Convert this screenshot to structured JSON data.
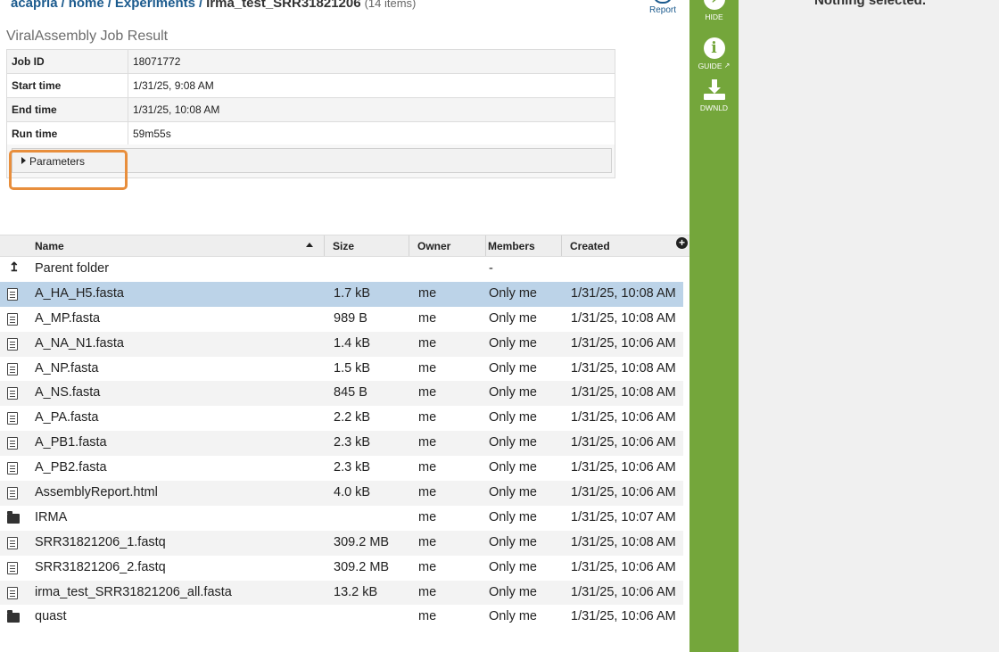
{
  "breadcrumb": {
    "parts": [
      "acapria",
      "home",
      "Experiments"
    ],
    "current": "irma_test_SRR31821206",
    "count": "(14 items)"
  },
  "report_label": "Report",
  "result_title": "ViralAssembly Job Result",
  "job": {
    "rows": [
      {
        "key": "Job ID",
        "value": "18071772"
      },
      {
        "key": "Start time",
        "value": "1/31/25, 9:08 AM"
      },
      {
        "key": "End time",
        "value": "1/31/25, 10:08 AM"
      },
      {
        "key": "Run time",
        "value": "59m55s"
      }
    ],
    "parameters_label": "Parameters"
  },
  "grid": {
    "columns": {
      "name": "Name",
      "size": "Size",
      "owner": "Owner",
      "members": "Members",
      "created": "Created"
    },
    "parent": {
      "name": "Parent folder",
      "members": "-"
    },
    "rows": [
      {
        "type": "file",
        "name": "A_HA_H5.fasta",
        "size": "1.7 kB",
        "owner": "me",
        "members": "Only me",
        "created": "1/31/25, 10:08 AM",
        "selected": true
      },
      {
        "type": "file",
        "name": "A_MP.fasta",
        "size": "989 B",
        "owner": "me",
        "members": "Only me",
        "created": "1/31/25, 10:08 AM"
      },
      {
        "type": "file",
        "name": "A_NA_N1.fasta",
        "size": "1.4 kB",
        "owner": "me",
        "members": "Only me",
        "created": "1/31/25, 10:06 AM"
      },
      {
        "type": "file",
        "name": "A_NP.fasta",
        "size": "1.5 kB",
        "owner": "me",
        "members": "Only me",
        "created": "1/31/25, 10:08 AM"
      },
      {
        "type": "file",
        "name": "A_NS.fasta",
        "size": "845 B",
        "owner": "me",
        "members": "Only me",
        "created": "1/31/25, 10:08 AM"
      },
      {
        "type": "file",
        "name": "A_PA.fasta",
        "size": "2.2 kB",
        "owner": "me",
        "members": "Only me",
        "created": "1/31/25, 10:06 AM"
      },
      {
        "type": "file",
        "name": "A_PB1.fasta",
        "size": "2.3 kB",
        "owner": "me",
        "members": "Only me",
        "created": "1/31/25, 10:06 AM"
      },
      {
        "type": "file",
        "name": "A_PB2.fasta",
        "size": "2.3 kB",
        "owner": "me",
        "members": "Only me",
        "created": "1/31/25, 10:06 AM"
      },
      {
        "type": "file",
        "name": "AssemblyReport.html",
        "size": "4.0 kB",
        "owner": "me",
        "members": "Only me",
        "created": "1/31/25, 10:06 AM"
      },
      {
        "type": "folder",
        "name": "IRMA",
        "size": "",
        "owner": "me",
        "members": "Only me",
        "created": "1/31/25, 10:07 AM"
      },
      {
        "type": "file",
        "name": "SRR31821206_1.fastq",
        "size": "309.2 MB",
        "owner": "me",
        "members": "Only me",
        "created": "1/31/25, 10:08 AM"
      },
      {
        "type": "file",
        "name": "SRR31821206_2.fastq",
        "size": "309.2 MB",
        "owner": "me",
        "members": "Only me",
        "created": "1/31/25, 10:06 AM"
      },
      {
        "type": "file",
        "name": "irma_test_SRR31821206_all.fasta",
        "size": "13.2 kB",
        "owner": "me",
        "members": "Only me",
        "created": "1/31/25, 10:06 AM"
      },
      {
        "type": "folder",
        "name": "quast",
        "size": "",
        "owner": "me",
        "members": "Only me",
        "created": "1/31/25, 10:06 AM"
      }
    ]
  },
  "actions": {
    "hide": "HIDE",
    "guide": "GUIDE",
    "download": "DWNLD"
  },
  "right_panel": {
    "message": "Nothing selected."
  },
  "colors": {
    "action_bar": "#74a63b",
    "selected_row": "#bcd3e8",
    "highlight": "#e88e3c",
    "link": "#1c5b8e"
  }
}
